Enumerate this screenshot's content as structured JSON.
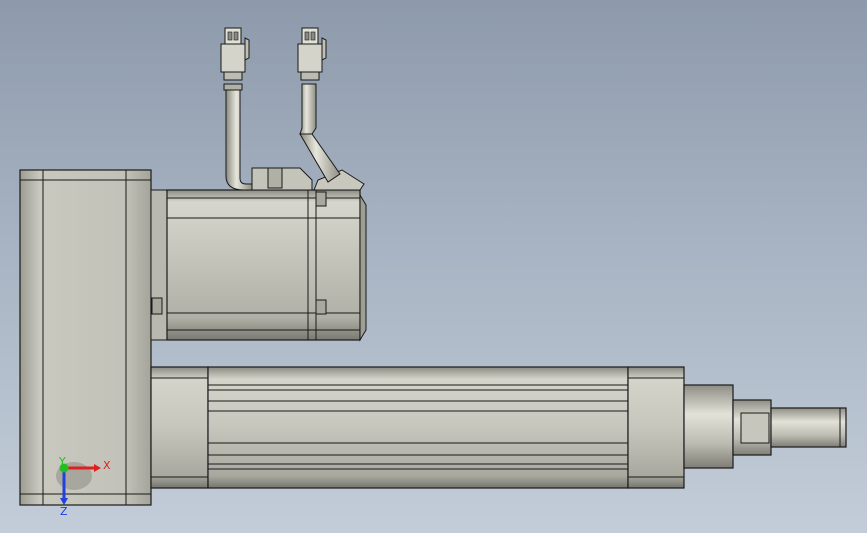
{
  "viewport": {
    "background_top": "#8d9aab",
    "background_bottom": "#c3cdd9"
  },
  "triad": {
    "x_label": "X",
    "y_label": "Y",
    "z_label": "Z",
    "x_color": "#e02020",
    "y_color": "#20c020",
    "z_color": "#2040e0"
  },
  "model": {
    "parts": [
      "mounting-block",
      "servo-motor",
      "cable-assembly-left",
      "cable-assembly-right",
      "connector-left",
      "connector-right",
      "actuator-tube",
      "front-end-cap",
      "rod-nose",
      "rod-bushing",
      "piston-rod"
    ]
  }
}
